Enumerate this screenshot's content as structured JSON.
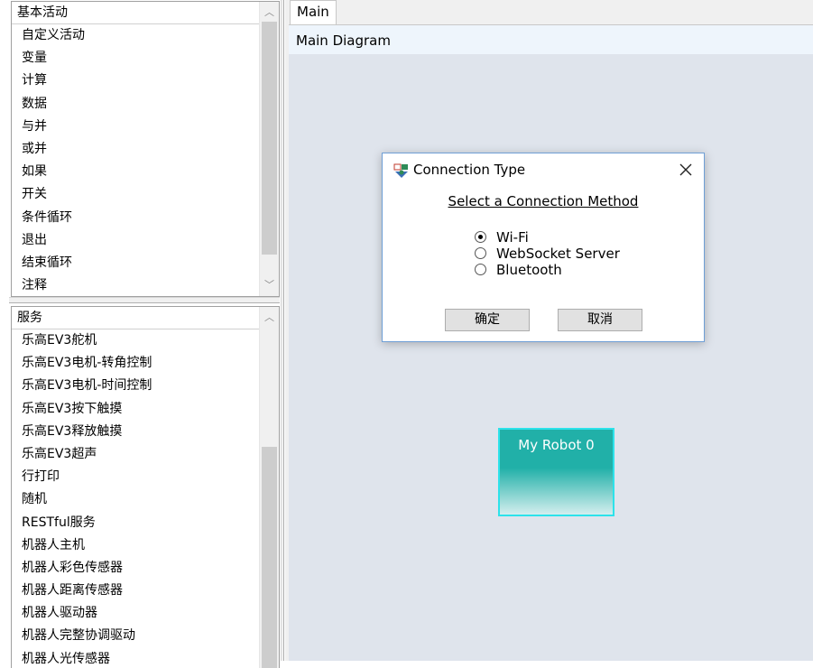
{
  "basic_panel": {
    "header": "基本活动",
    "items": [
      "自定义活动",
      "变量",
      "计算",
      "数据",
      "与并",
      "或并",
      "如果",
      "开关",
      "条件循环",
      "退出",
      "结束循环",
      "注释"
    ]
  },
  "services_panel": {
    "header": "服务",
    "items": [
      "乐高EV3舵机",
      "乐高EV3电机-转角控制",
      "乐高EV3电机-时间控制",
      "乐高EV3按下触摸",
      "乐高EV3释放触摸",
      "乐高EV3超声",
      "行打印",
      "随机",
      "RESTful服务",
      "机器人主机",
      "机器人彩色传感器",
      "机器人距离传感器",
      "机器人驱动器",
      "机器人完整协调驱动",
      "机器人光传感器"
    ]
  },
  "tabs": [
    "Main"
  ],
  "diagram_title": "Main Diagram",
  "dialog": {
    "title": "Connection Type",
    "heading": "Select a Connection Method",
    "options": [
      "Wi-Fi",
      "WebSocket Server",
      "Bluetooth"
    ],
    "selected": "Wi-Fi",
    "ok_label": "确定",
    "cancel_label": "取消"
  },
  "robot_block": {
    "label": "My Robot 0"
  },
  "colors": {
    "canvas_bg": "#dfe4ec",
    "robot_teal": "#21b0a8",
    "robot_border": "#2de2ea",
    "dialog_border": "#6f9fd6"
  }
}
